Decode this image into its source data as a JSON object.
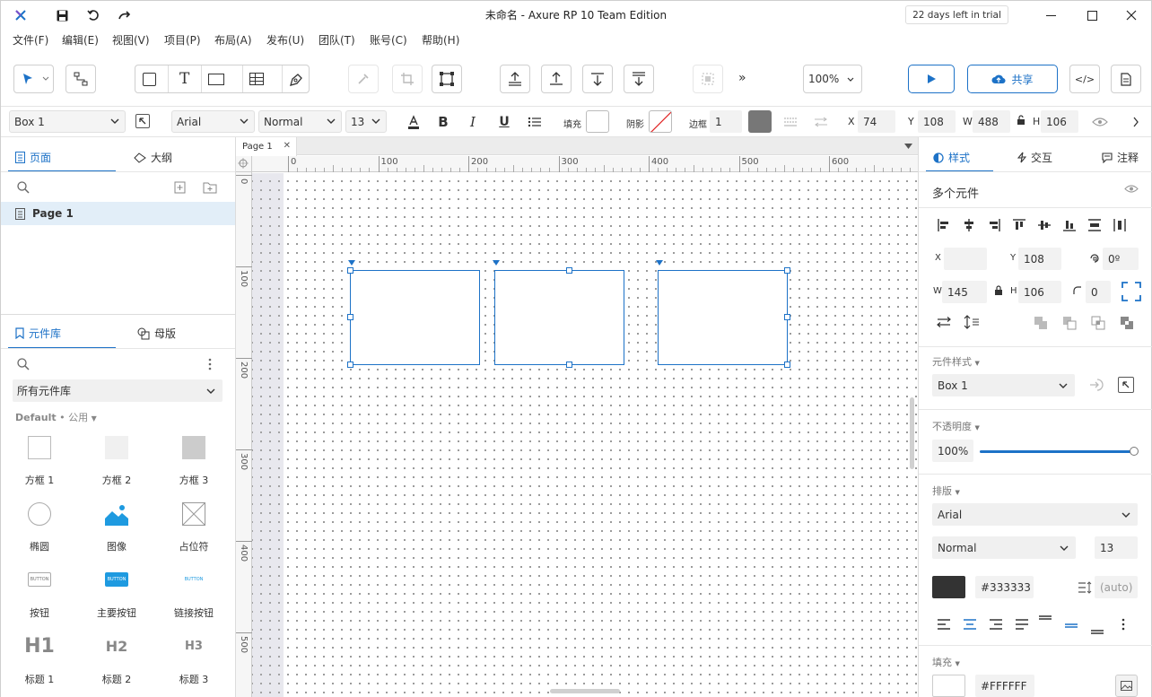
{
  "titlebar": {
    "title": "未命名 - Axure RP 10 Team Edition",
    "trial_badge": "22 days left in trial"
  },
  "menu": [
    "文件(F)",
    "编辑(E)",
    "视图(V)",
    "项目(P)",
    "布局(A)",
    "发布(U)",
    "团队(T)",
    "账号(C)",
    "帮助(H)"
  ],
  "toolbar": {
    "zoom": "100%",
    "share_label": "共享",
    "more": "»"
  },
  "formatbar": {
    "style_name": "Box 1",
    "font_family": "Arial",
    "font_weight": "Normal",
    "font_size": "13",
    "fill_label": "填充",
    "shadow_label": "阴影",
    "border_label": "边框",
    "border_width": "1",
    "x_label": "X",
    "x_value": "74",
    "y_label": "Y",
    "y_value": "108",
    "w_label": "W",
    "w_value": "488",
    "h_label": "H",
    "h_value": "106"
  },
  "left_panel": {
    "tabs": {
      "pages": "页面",
      "outline": "大纲"
    },
    "page_items": [
      "Page 1"
    ],
    "lib_tabs": {
      "library": "元件库",
      "masters": "母版"
    },
    "library_select": "所有元件库",
    "library_group": "Default",
    "library_group_sub": "• 公用",
    "widgets": [
      {
        "label": "方框 1",
        "icon": "box1-icon"
      },
      {
        "label": "方框 2",
        "icon": "box2-icon"
      },
      {
        "label": "方框 3",
        "icon": "box3-icon"
      },
      {
        "label": "椭圆",
        "icon": "ellipse-icon"
      },
      {
        "label": "图像",
        "icon": "image-icon"
      },
      {
        "label": "占位符",
        "icon": "placeholder-icon"
      },
      {
        "label": "按钮",
        "icon": "button-icon",
        "text": "BUTTON"
      },
      {
        "label": "主要按钮",
        "icon": "primary-button-icon",
        "text": "BUTTON"
      },
      {
        "label": "链接按钮",
        "icon": "link-button-icon",
        "text": "BUTTON"
      },
      {
        "label": "标题 1",
        "icon": "heading1-icon",
        "text": "H1"
      },
      {
        "label": "标题 2",
        "icon": "heading2-icon",
        "text": "H2"
      },
      {
        "label": "标题 3",
        "icon": "heading3-icon",
        "text": "H3"
      }
    ]
  },
  "canvas": {
    "page_tab": "Page 1",
    "hruler": [
      "0",
      "100",
      "200",
      "300",
      "400",
      "500",
      "600"
    ],
    "vruler": [
      "0",
      "100",
      "200",
      "300",
      "400",
      "500"
    ]
  },
  "right_panel": {
    "tabs": {
      "style": "样式",
      "interactions": "交互",
      "notes": "注释"
    },
    "heading": "多个元件",
    "x_label": "X",
    "x_value": "",
    "y_label": "Y",
    "y_value": "108",
    "rotation": "0º",
    "w_label": "W",
    "w_value": "145",
    "h_label": "H",
    "h_value": "106",
    "radius": "0",
    "widget_style_title": "元件样式",
    "widget_style_value": "Box 1",
    "opacity_title": "不透明度",
    "opacity_value": "100%",
    "opacity_fraction": 1.0,
    "typography_title": "排版",
    "font_family": "Arial",
    "font_weight": "Normal",
    "font_size": "13",
    "text_color": "#333333",
    "line_height": "(auto)",
    "fill_title": "填充",
    "fill_color": "#FFFFFF"
  },
  "colors": {
    "accent": "#1d72c7",
    "border_swatch": "#777777",
    "text_swatch": "#333333",
    "shadow_none": "#e02020"
  }
}
